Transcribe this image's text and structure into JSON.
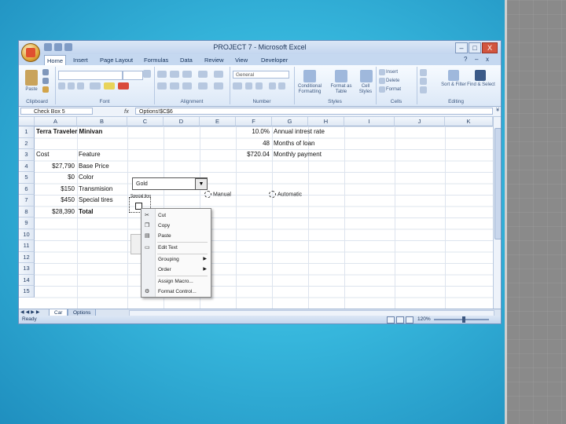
{
  "window": {
    "title": "PROJECT 7 - Microsoft Excel",
    "buttons": {
      "minimize": "–",
      "maximize": "□",
      "close": "X"
    }
  },
  "ribbon": {
    "tabs": [
      "Home",
      "Insert",
      "Page Layout",
      "Formulas",
      "Data",
      "Review",
      "View",
      "Developer"
    ],
    "active_tab": "Home",
    "groups": [
      "Clipboard",
      "Font",
      "Alignment",
      "Number",
      "Styles",
      "Cells",
      "Editing"
    ],
    "paste_label": "Paste",
    "number_format": "General",
    "style_buttons": [
      "Conditional Formatting",
      "Format as Table",
      "Cell Styles"
    ],
    "cells_buttons": [
      "Insert",
      "Delete",
      "Format"
    ],
    "editing_buttons": [
      "Sort & Filter",
      "Find & Select"
    ]
  },
  "formula_bar": {
    "name_box": "Check Box 5",
    "fx": "fx",
    "formula": "Options!$C$6"
  },
  "columns": [
    "A",
    "B",
    "C",
    "D",
    "E",
    "F",
    "G",
    "H",
    "I",
    "J",
    "K"
  ],
  "rows": [
    "1",
    "2",
    "3",
    "4",
    "5",
    "6",
    "7",
    "8",
    "9",
    "10",
    "11",
    "12",
    "13",
    "14",
    "15"
  ],
  "cells": {
    "a1": "Terra Traveler Minivan",
    "f1": "10.0%",
    "g1": "Annual intrest rate",
    "f2": "48",
    "g2": "Months of loan",
    "a3": "Cost",
    "b3": "Feature",
    "f3": "$720.04",
    "g3": "Monthly payment",
    "a4": "$27,790",
    "b4": "Base Price",
    "a5": "$0",
    "b5": "Color",
    "a6": "$150",
    "b6": "Transmision",
    "a7": "$450",
    "b7": "Special tires",
    "a8": "$28,390",
    "b8": "Total"
  },
  "controls": {
    "combo_value": "Gold",
    "checkbox_label": "Special tires",
    "option_manual": "Manual",
    "option_automatic": "Automatic"
  },
  "context_menu": {
    "items": [
      "Cut",
      "Copy",
      "Paste",
      "Edit Text",
      "Grouping",
      "Order",
      "Assign Macro...",
      "Format Control..."
    ]
  },
  "sheets": [
    "Car",
    "Options"
  ],
  "active_sheet": "Car",
  "status": {
    "ready": "Ready",
    "zoom": "120%"
  },
  "colors": {
    "background": "#36b6dc",
    "ribbon": "#dce8f7",
    "accent": "#c3d6ef"
  }
}
